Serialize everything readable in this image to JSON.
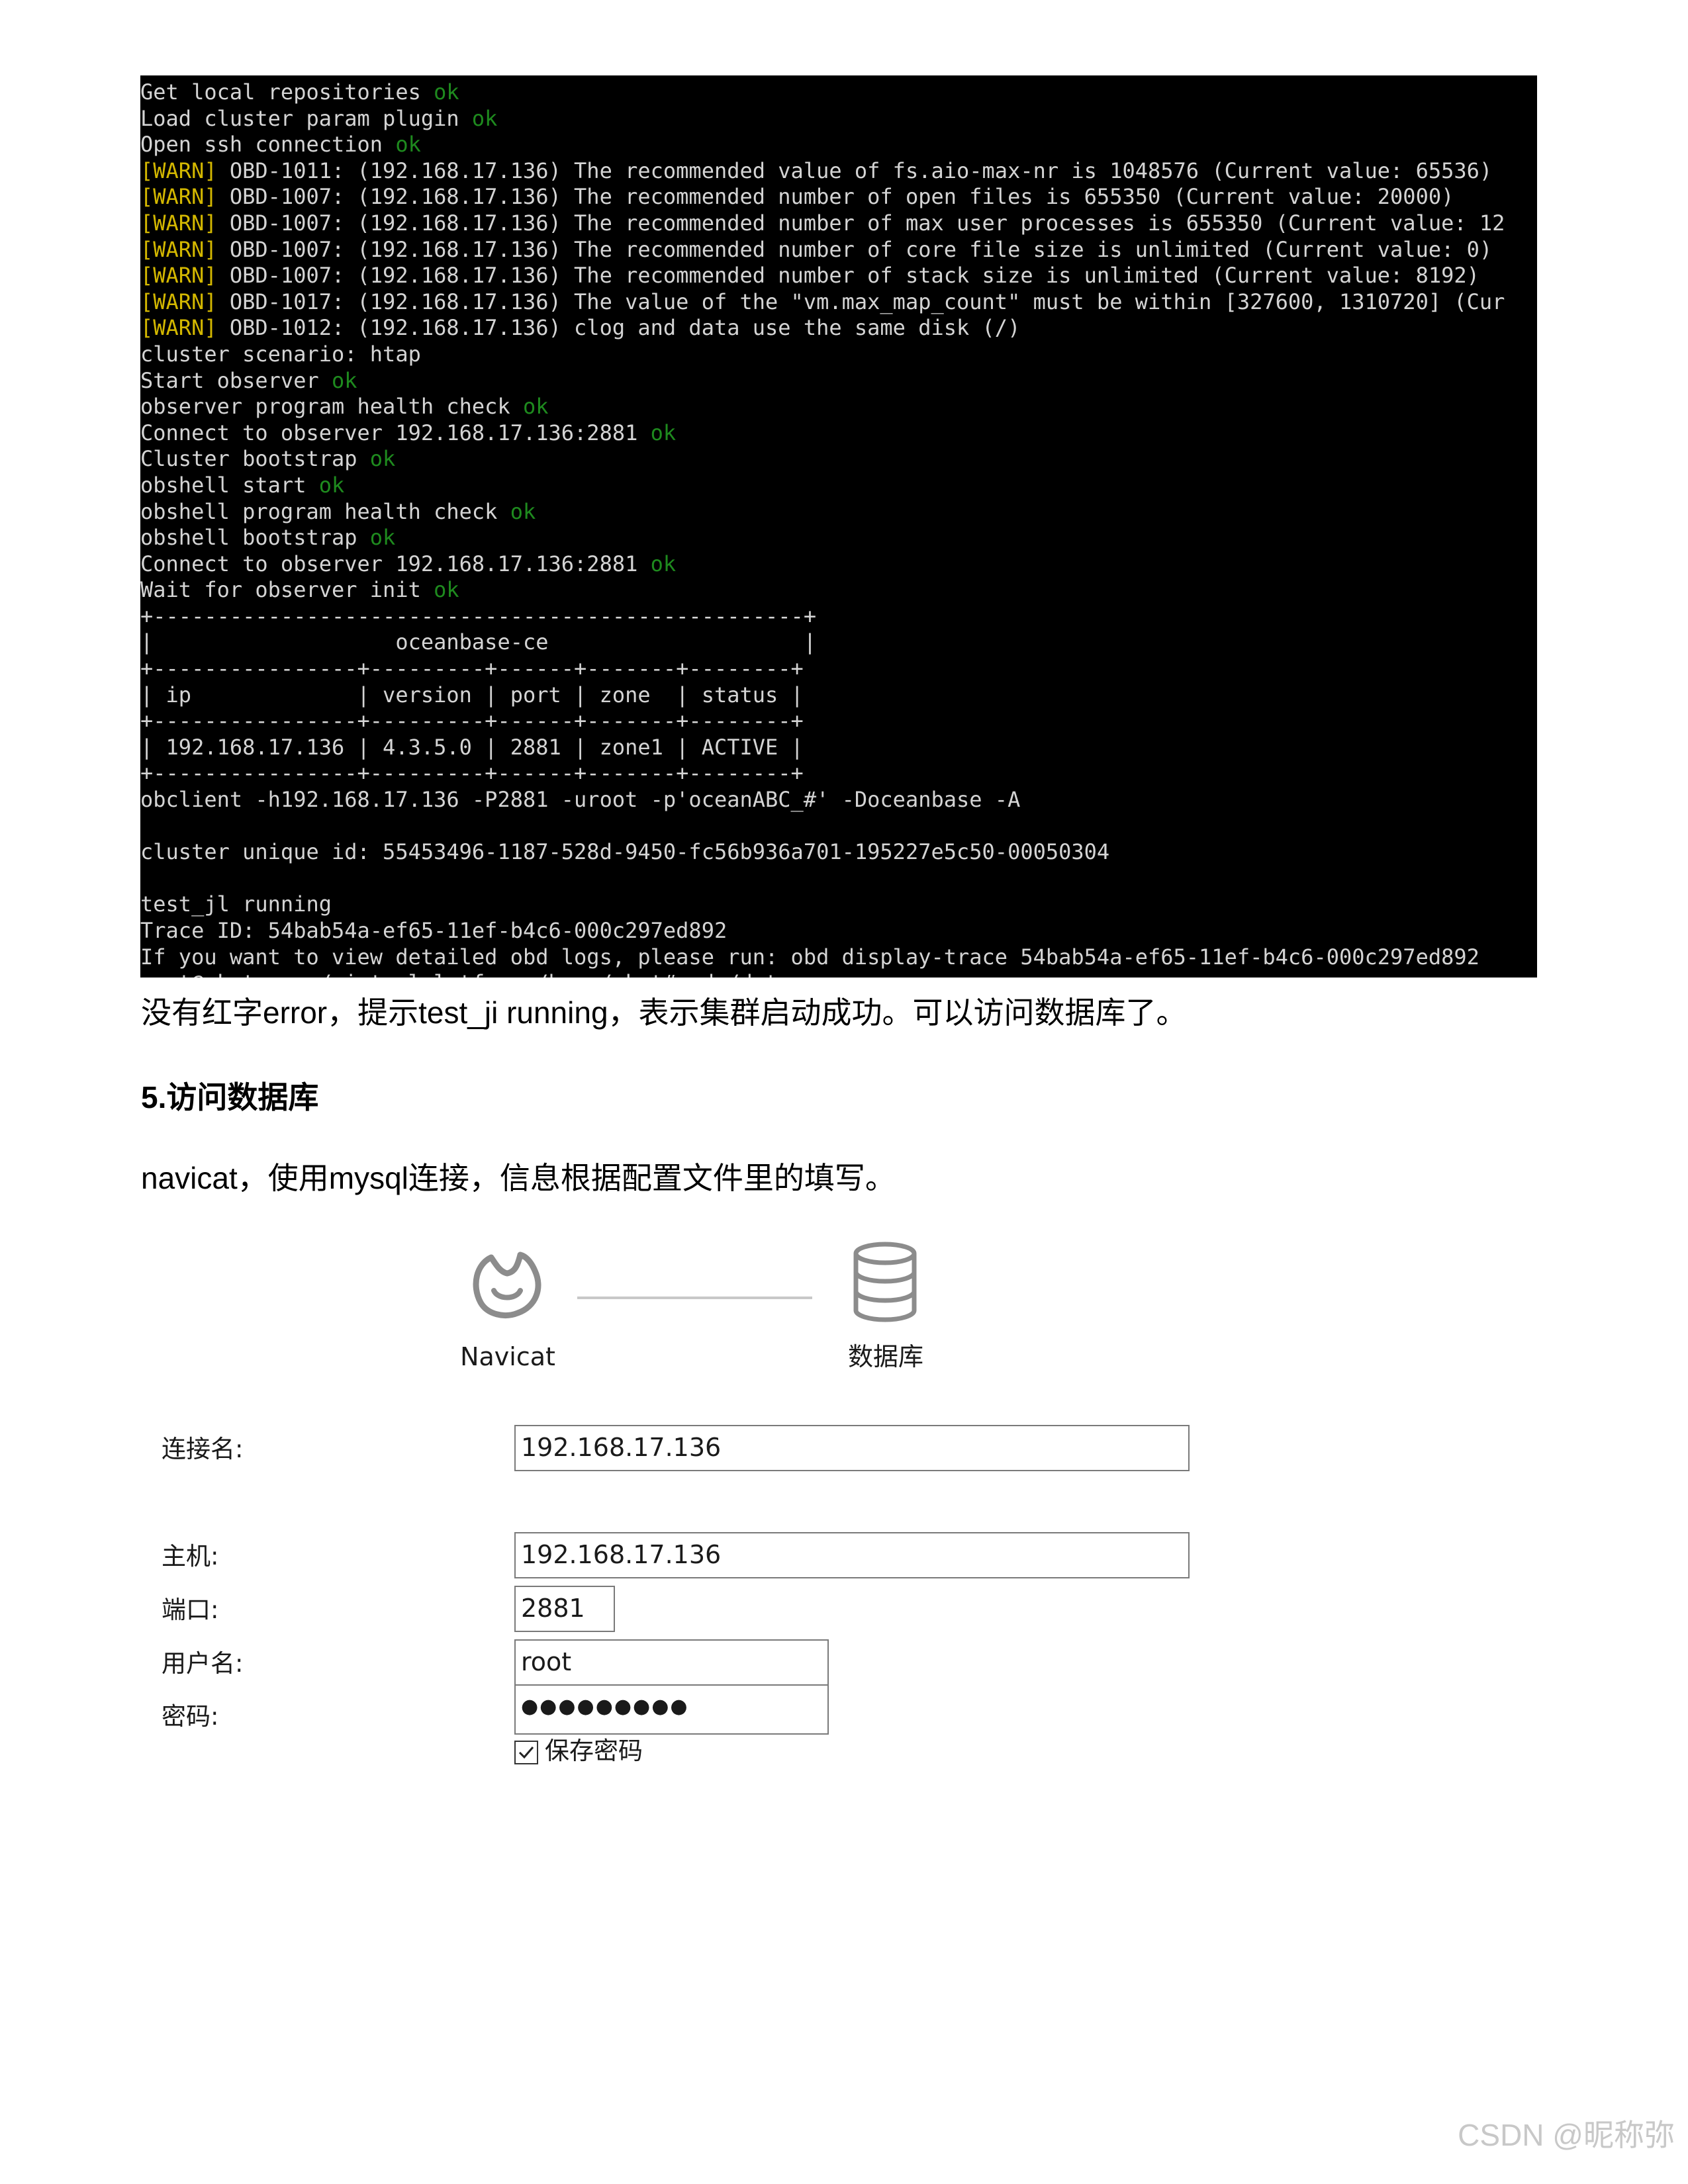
{
  "terminal": {
    "lines": [
      [
        {
          "t": "Get local repositories "
        },
        {
          "t": "ok",
          "c": "ok"
        }
      ],
      [
        {
          "t": "Load cluster param plugin "
        },
        {
          "t": "ok",
          "c": "ok"
        }
      ],
      [
        {
          "t": "Open ssh connection "
        },
        {
          "t": "ok",
          "c": "ok"
        }
      ],
      [
        {
          "t": "[WARN]",
          "c": "warn"
        },
        {
          "t": " OBD-1011: (192.168.17.136) The recommended value of fs.aio-max-nr is 1048576 (Current value: 65536)"
        }
      ],
      [
        {
          "t": "[WARN]",
          "c": "warn"
        },
        {
          "t": " OBD-1007: (192.168.17.136) The recommended number of open files is 655350 (Current value: 20000)"
        }
      ],
      [
        {
          "t": "[WARN]",
          "c": "warn"
        },
        {
          "t": " OBD-1007: (192.168.17.136) The recommended number of max user processes is 655350 (Current value: 12"
        }
      ],
      [
        {
          "t": "[WARN]",
          "c": "warn"
        },
        {
          "t": " OBD-1007: (192.168.17.136) The recommended number of core file size is unlimited (Current value: 0)"
        }
      ],
      [
        {
          "t": "[WARN]",
          "c": "warn"
        },
        {
          "t": " OBD-1007: (192.168.17.136) The recommended number of stack size is unlimited (Current value: 8192)"
        }
      ],
      [
        {
          "t": "[WARN]",
          "c": "warn"
        },
        {
          "t": " OBD-1017: (192.168.17.136) The value of the \"vm.max_map_count\" must be within [327600, 1310720] (Cur"
        }
      ],
      [
        {
          "t": "[WARN]",
          "c": "warn"
        },
        {
          "t": " OBD-1012: (192.168.17.136) clog and data use the same disk (/)"
        }
      ],
      [
        {
          "t": "cluster scenario: htap"
        }
      ],
      [
        {
          "t": "Start observer "
        },
        {
          "t": "ok",
          "c": "ok"
        }
      ],
      [
        {
          "t": "observer program health check "
        },
        {
          "t": "ok",
          "c": "ok"
        }
      ],
      [
        {
          "t": "Connect to observer 192.168.17.136:2881 "
        },
        {
          "t": "ok",
          "c": "ok"
        }
      ],
      [
        {
          "t": "Cluster bootstrap "
        },
        {
          "t": "ok",
          "c": "ok"
        }
      ],
      [
        {
          "t": "obshell start "
        },
        {
          "t": "ok",
          "c": "ok"
        }
      ],
      [
        {
          "t": "obshell program health check "
        },
        {
          "t": "ok",
          "c": "ok"
        }
      ],
      [
        {
          "t": "obshell bootstrap "
        },
        {
          "t": "ok",
          "c": "ok"
        }
      ],
      [
        {
          "t": "Connect to observer 192.168.17.136:2881 "
        },
        {
          "t": "ok",
          "c": "ok"
        }
      ],
      [
        {
          "t": "Wait for observer init "
        },
        {
          "t": "ok",
          "c": "ok"
        }
      ],
      [
        {
          "t": "+---------------------------------------------------+"
        }
      ],
      [
        {
          "t": "|                   oceanbase-ce                    |"
        }
      ],
      [
        {
          "t": "+----------------+---------+------+-------+--------+"
        }
      ],
      [
        {
          "t": "| ip             | version | port | zone  | status |"
        }
      ],
      [
        {
          "t": "+----------------+---------+------+-------+--------+"
        }
      ],
      [
        {
          "t": "| 192.168.17.136 | 4.3.5.0 | 2881 | zone1 | ACTIVE |"
        }
      ],
      [
        {
          "t": "+----------------+---------+------+-------+--------+"
        }
      ],
      [
        {
          "t": "obclient -h192.168.17.136 -P2881 -uroot -p'oceanABC_#' -Doceanbase -A"
        }
      ],
      [
        {
          "t": ""
        }
      ],
      [
        {
          "t": "cluster unique id: 55453496-1187-528d-9450-fc56b936a701-195227e5c50-00050304"
        }
      ],
      [
        {
          "t": ""
        }
      ],
      [
        {
          "t": "test_jl running"
        }
      ],
      [
        {
          "t": "Trace ID: 54bab54a-ef65-11ef-b4c6-000c297ed892"
        }
      ],
      [
        {
          "t": "If you want to view detailed obd logs, please run: obd display-trace 54bab54a-ef65-11ef-b4c6-000c297ed892"
        }
      ],
      [
        {
          "t": "root@sket-vm:~/virtualplatform:/home/sket# cd /data"
        }
      ]
    ]
  },
  "doc": {
    "para1": "没有红字error，提示test_ji running，表示集群启动成功。可以访问数据库了。",
    "heading": "5.访问数据库",
    "para2": "navicat，使用mysql连接，信息根据配置文件里的填写。"
  },
  "dialog": {
    "navicat_label": "Navicat",
    "db_label": "数据库",
    "connection_name_label": "连接名:",
    "connection_name_value": "192.168.17.136",
    "host_label": "主机:",
    "host_value": "192.168.17.136",
    "port_label": "端口:",
    "port_value": "2881",
    "username_label": "用户名:",
    "username_value": "root",
    "password_label": "密码:",
    "password_masked": "●●●●●●●●●",
    "save_password_label": "保存密码",
    "save_password_checked": true
  },
  "watermark": "CSDN @昵称弥",
  "colors": {
    "ok": "#1e8a1e",
    "warn": "#d4b800",
    "terminal_bg": "#000000",
    "terminal_fg": "#d4d4d4"
  }
}
